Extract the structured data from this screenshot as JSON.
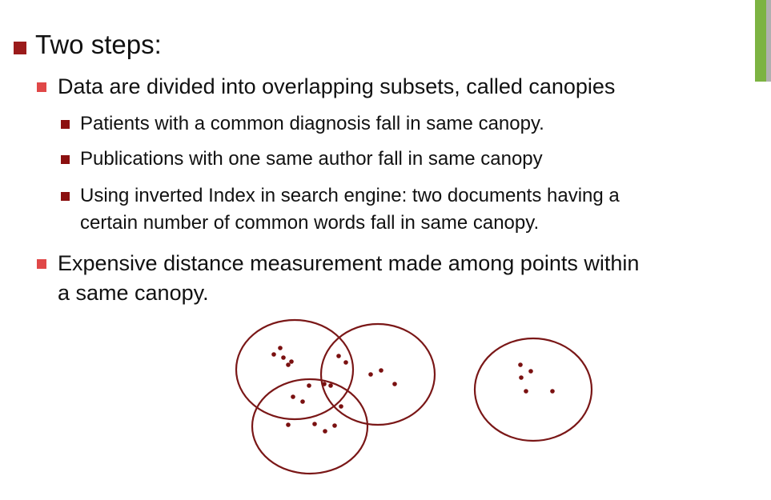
{
  "slide": {
    "heading": "Two steps:",
    "step1": {
      "text": "Data are divided into overlapping subsets, called canopies",
      "examples": [
        "Patients with a common diagnosis fall in same canopy.",
        "Publications with one same author fall in same canopy",
        "Using inverted Index in search engine: two documents having a",
        "certain number of common words fall in same canopy."
      ]
    },
    "step2": {
      "line1": "Expensive distance measurement made among points within",
      "line2": "a same canopy."
    }
  },
  "colors": {
    "heading_bullet": "#9b1b1b",
    "step_bullet": "#e04848",
    "example_bullet": "#8b1010",
    "canopy_stroke": "#7a1717",
    "point_fill": "#7a1010",
    "accent_green": "#7cb342"
  }
}
